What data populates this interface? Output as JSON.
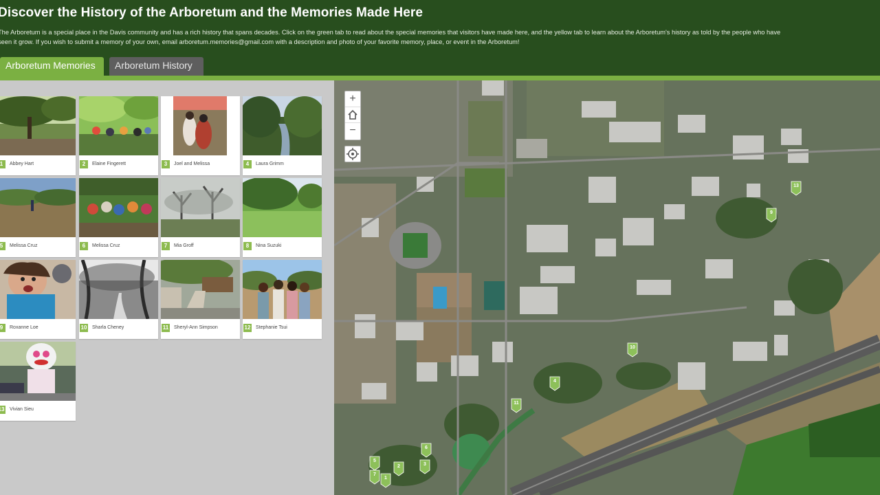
{
  "header": {
    "title": "Discover the History of the Arboretum and the Memories Made Here",
    "desc_line1": "The Arboretum is a special place in the Davis community and has a rich history that spans decades. Click on the green tab to read about the special memories that visitors have made here, and the yellow tab to learn about the Arboretum's history as told by the people who have",
    "desc_line2": "seen it grow. If you wish to submit a memory of your own, email arboretum.memories@gmail.com with a description and photo of your favorite memory, place, or event in the Arboretum!"
  },
  "tabs": {
    "memories": "Arboretum Memories",
    "history": "Arboretum History"
  },
  "gallery": {
    "items": [
      {
        "num": "1",
        "name": "Abbey Hart"
      },
      {
        "num": "2",
        "name": "Elaine Fingerett"
      },
      {
        "num": "3",
        "name": "Joel and Melissa"
      },
      {
        "num": "4",
        "name": "Laura Grimm"
      },
      {
        "num": "5",
        "name": "Melissa Cruz"
      },
      {
        "num": "6",
        "name": "Melissa Cruz"
      },
      {
        "num": "7",
        "name": "Mia Groff"
      },
      {
        "num": "8",
        "name": "Nina Suzuki"
      },
      {
        "num": "9",
        "name": "Roxanne Loe"
      },
      {
        "num": "10",
        "name": "Sharla Cheney"
      },
      {
        "num": "11",
        "name": "Sheryl-Ann Simpson"
      },
      {
        "num": "12",
        "name": "Stephanie Tsui"
      },
      {
        "num": "13",
        "name": "Vivian Sieu"
      }
    ]
  },
  "map": {
    "zoom_in": "+",
    "zoom_out": "−",
    "pins": [
      "13",
      "9",
      "10",
      "4",
      "11",
      "6",
      "3",
      "2",
      "5",
      "7",
      "1"
    ]
  },
  "colors": {
    "header": "#284e1e",
    "accent": "#7bb042",
    "pin": "#8dc05a"
  }
}
